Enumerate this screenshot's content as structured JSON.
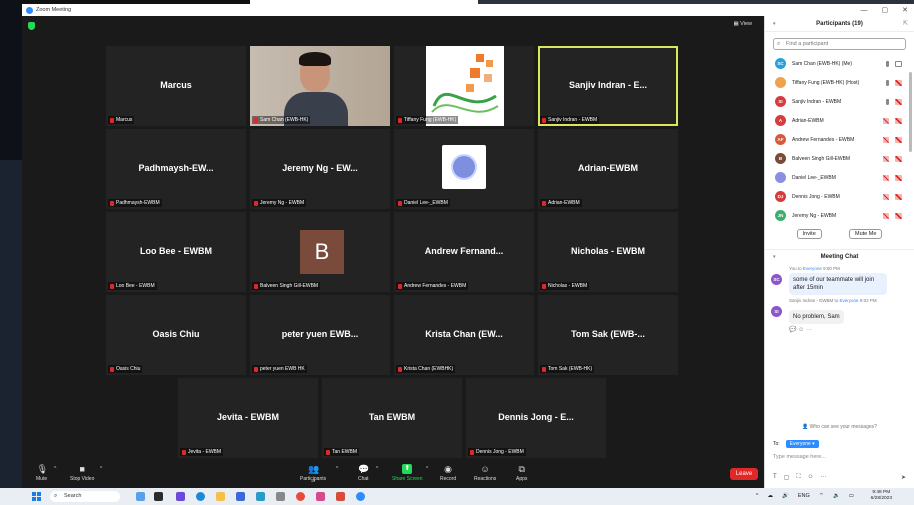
{
  "window": {
    "title": "Zoom Meeting",
    "controls": [
      "—",
      "▢",
      "✕"
    ]
  },
  "view_label": "View",
  "tiles": [
    {
      "name": "Marcus",
      "label": "Marcus",
      "type": "name"
    },
    {
      "name": "",
      "label": "Sam Chan (EWB-HK)",
      "type": "camera"
    },
    {
      "name": "",
      "label": "Tiffany Fung (EWB-HK)",
      "type": "logo"
    },
    {
      "name": "Sanjiv Indran - E...",
      "label": "Sanjiv Indran - EWBM",
      "type": "name",
      "active": true
    },
    {
      "name": "Padhmaysh-EW...",
      "label": "Padhmaysh-EWBM",
      "type": "name"
    },
    {
      "name": "Jeremy Ng - EW...",
      "label": "Jeremy Ng - EWBM",
      "type": "name"
    },
    {
      "name": "",
      "label": "Daniel Lee-_EWBM",
      "type": "avatar-daniel"
    },
    {
      "name": "Adrian-EWBM",
      "label": "Adrian-EWBM",
      "type": "name"
    },
    {
      "name": "Loo Bee - EWBM",
      "label": "Loo Bee - EWBM",
      "type": "name"
    },
    {
      "name": "",
      "label": "Balveen Singh Gill-EWBM",
      "type": "avatar-b",
      "avatar_letter": "B"
    },
    {
      "name": "Andrew Fernand...",
      "label": "Andrew Fernandes - EWBM",
      "type": "name"
    },
    {
      "name": "Nicholas - EWBM",
      "label": "Nicholas - EWBM",
      "type": "name"
    },
    {
      "name": "Oasis Chiu",
      "label": "Oasis Chiu",
      "type": "name"
    },
    {
      "name": "peter yuen EWB...",
      "label": "peter yuen EWB HK",
      "type": "name"
    },
    {
      "name": "Krista Chan (EW...",
      "label": "Krista Chan (EWBHK)",
      "type": "name"
    },
    {
      "name": "Tom Sak (EWB-...",
      "label": "Tom Sak (EWB-HK)",
      "type": "name"
    },
    {
      "name": "Jevita - EWBM",
      "label": "Jevita - EWBM",
      "type": "name"
    },
    {
      "name": "Tan EWBM",
      "label": "Tan EWBM",
      "type": "name"
    },
    {
      "name": "Dennis Jong - E...",
      "label": "Dennis Jong - EWBM",
      "type": "name"
    }
  ],
  "toolbar": {
    "mute": "Mute",
    "stop_video": "Stop Video",
    "participants": "Participants",
    "participants_count": "19",
    "chat": "Chat",
    "share_screen": "Share Screen",
    "record": "Record",
    "reactions": "Reactions",
    "apps": "Apps",
    "leave": "Leave"
  },
  "participants_panel": {
    "title": "Participants (19)",
    "search_placeholder": "Find a participant",
    "list": [
      {
        "initials": "SC",
        "name": "Sam Chan (EWB-HK) (Me)",
        "color": "#2aa0d8",
        "mic": "on",
        "video": "on"
      },
      {
        "initials": "",
        "name": "Tiffany Fung (EWB-HK) (Host)",
        "color": "#f0a24a",
        "mic": "on",
        "video": "off"
      },
      {
        "initials": "SI",
        "name": "Sanjiv Indran - EWBM",
        "color": "#d63c3c",
        "mic": "on",
        "video": "off"
      },
      {
        "initials": "A",
        "name": "Adrian-EWBM",
        "color": "#d63c3c",
        "mic": "off",
        "video": "off"
      },
      {
        "initials": "AF",
        "name": "Andrew Fernandes - EWBM",
        "color": "#d65a3c",
        "mic": "off",
        "video": "off"
      },
      {
        "initials": "B",
        "name": "Balveen Singh Gill-EWBM",
        "color": "#7a4a3a",
        "mic": "off",
        "video": "off"
      },
      {
        "initials": "",
        "name": "Daniel Lee-_EWBM",
        "color": "#8b8fe0",
        "mic": "off",
        "video": "off"
      },
      {
        "initials": "DJ",
        "name": "Dennis Jong - EWBM",
        "color": "#d63c3c",
        "mic": "off",
        "video": "off"
      },
      {
        "initials": "JN",
        "name": "Jeremy Ng - EWBM",
        "color": "#3cb06a",
        "mic": "off",
        "video": "off"
      }
    ],
    "invite": "Invite",
    "mute_me": "Mute Me"
  },
  "chat_panel": {
    "title": "Meeting Chat",
    "messages": [
      {
        "initials": "SC",
        "color": "#8a56c9",
        "sender": "You",
        "to": "Everyone",
        "time": "9:00 PM",
        "text": "some of our teammate will join after 15min"
      },
      {
        "initials": "SI",
        "color": "#8a56c9",
        "sender": "Sanjiv Indran - EWBM",
        "to": "Everyone",
        "time": "9:02 PM",
        "text": "No problem, Sam"
      }
    ],
    "who_can_see": "Who can see your messages?",
    "to_label": "To:",
    "to_value": "Everyone",
    "placeholder": "Type message here..."
  },
  "taskbar": {
    "search": "Search",
    "lang": "ENG",
    "time": "9:48 PM",
    "date": "6/28/2023"
  }
}
